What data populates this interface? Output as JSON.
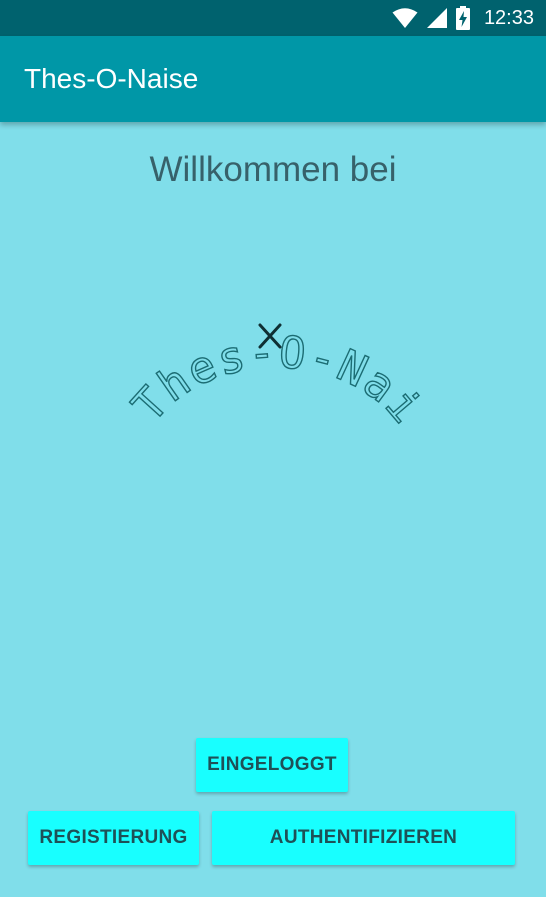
{
  "status_bar": {
    "time": "12:33",
    "icons": [
      "wifi-icon",
      "cell-signal-icon",
      "battery-charging-icon"
    ]
  },
  "app_bar": {
    "title": "Thes-O-Naise"
  },
  "main": {
    "welcome_text": "Willkommen bei",
    "logo_text": "Thes-O-Naise"
  },
  "buttons": {
    "eingeloggt": "EINGELOGGT",
    "registrierung": "REGISTIERUNG",
    "authentifizieren": "AUTHENTIFIZIEREN"
  },
  "colors": {
    "status_bar": "#00626E",
    "app_bar": "#0097A7",
    "background": "#80DEEA",
    "button": "#18FFFF",
    "button_text": "#1E5157",
    "welcome_text": "#37616A",
    "logo_stroke": "#1B6C73"
  }
}
